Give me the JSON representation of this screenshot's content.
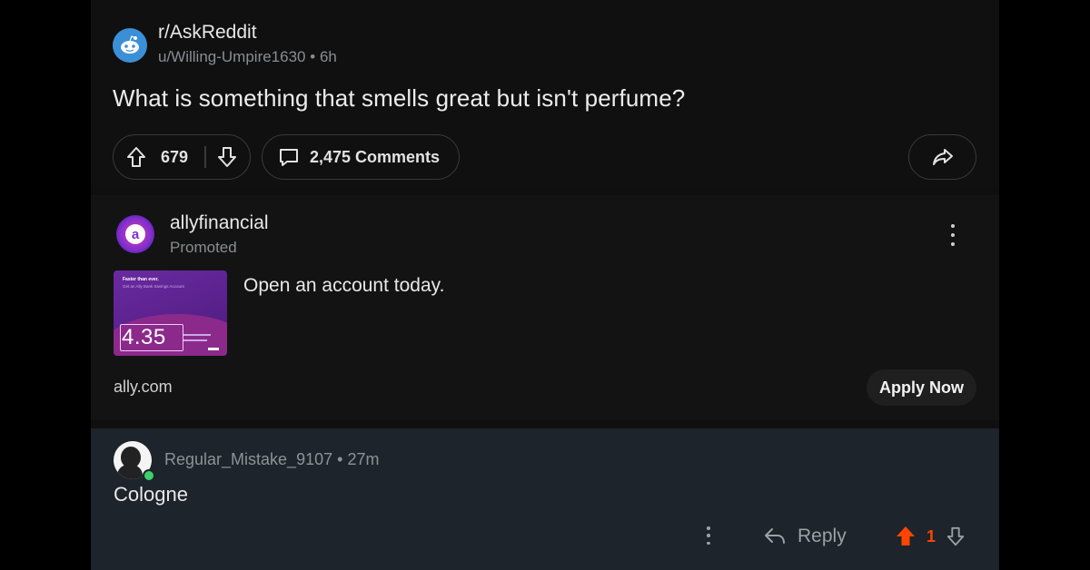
{
  "post": {
    "subreddit": "r/AskReddit",
    "author": "u/Willing-Umpire1630",
    "age": "6h",
    "title": "What is something that smells great but isn't perfume?",
    "votes": "679",
    "comments_label": "2,475 Comments"
  },
  "ad": {
    "advertiser": "allyfinancial",
    "promoted_label": "Promoted",
    "avatar_letter": "a",
    "thumbnail": {
      "line1": "Faster than ever.",
      "line2": "Get an Ally Bank Savings Account",
      "rate": "4.35"
    },
    "headline": "Open an account today.",
    "domain": "ally.com",
    "cta_label": "Apply Now"
  },
  "comment": {
    "author": "Regular_Mistake_9107",
    "age": "27m",
    "body": "Cologne",
    "reply_label": "Reply",
    "votes": "1",
    "upvote_color": "#ff4500"
  },
  "colors": {
    "background": "#000000",
    "card": "#101010",
    "comment_bg": "#1d242b",
    "accent_upvote": "#ff4500",
    "online": "#3cd16b"
  },
  "icons": {
    "post_upvote": "arrow-up-outline-icon",
    "post_downvote": "arrow-down-outline-icon",
    "comments": "speech-bubble-icon",
    "share": "share-arrow-icon",
    "ad_menu": "vertical-dots-icon",
    "comment_menu": "vertical-dots-icon",
    "reply": "reply-arrow-icon",
    "comment_upvote": "arrow-up-filled-icon",
    "comment_downvote": "arrow-down-outline-icon"
  }
}
